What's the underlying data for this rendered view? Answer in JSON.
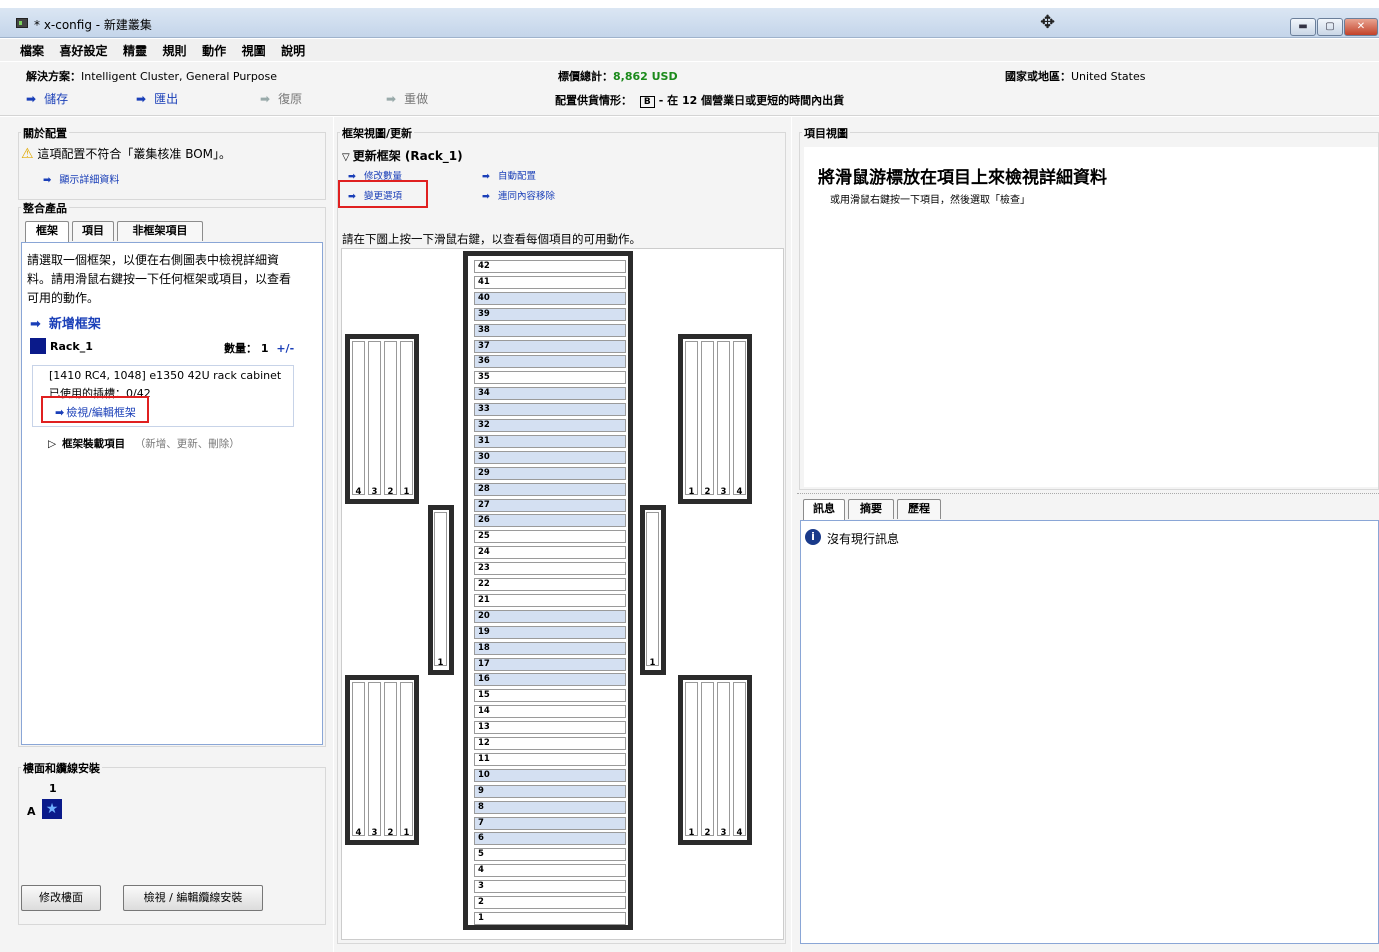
{
  "window": {
    "title": "* x-config - 新建叢集"
  },
  "menu": [
    "檔案",
    "喜好設定",
    "精靈",
    "規則",
    "動作",
    "視圖",
    "說明"
  ],
  "infobar": {
    "solution_label": "解決方案：",
    "solution_value": "Intelligent Cluster, General Purpose",
    "price_label": "標價總計：",
    "price_value": "8,862 USD",
    "country_label": "國家或地區：",
    "country_value": "United States",
    "save": "儲存",
    "export": "匯出",
    "undo": "復原",
    "redo": "重做",
    "supply_label": "配置供貨情形：",
    "supply_badge": "B",
    "supply_text": "- 在 12 個營業日或更短的時間內出貨"
  },
  "about": {
    "title": "關於配置",
    "warning": "這項配置不符合「叢集核准 BOM」。",
    "details_link": "顯示詳細資料"
  },
  "integrated": {
    "title": "整合產品",
    "tabs": [
      "框架",
      "項目",
      "非框架項目"
    ],
    "instructions": [
      "請選取一個框架，以便在右側圖表中檢視詳細資",
      "料。請用滑鼠右鍵按一下任何框架或項目，以查看",
      "可用的動作。"
    ],
    "add_rack": "新增框架",
    "rack_name": "Rack_1",
    "qty_label": "數量：",
    "qty_value": "1",
    "qty_adjust": "+/-",
    "rack_desc": "[1410 RC4, 1048] e1350 42U rack cabinet",
    "slots_used": "已使用的插槽：0/42",
    "view_edit_rack": "檢視/編輯框架",
    "rack_items": "框架裝載項目",
    "rack_items_hint": "（新增、更新、刪除）"
  },
  "floor": {
    "title": "樓面和纜線安裝",
    "col_label": "1",
    "row_label": "A",
    "modify_button": "修改樓面",
    "cabling_button": "檢視 / 編輯纜線安裝"
  },
  "rackview": {
    "title": "框架視圖/更新",
    "update_header": "更新框架 (Rack_1)",
    "modify_qty": "修改數量",
    "auto_config": "自動配置",
    "change_option": "變更選項",
    "move_contents": "連同內容移除",
    "instruction": "請在下圖上按一下滑鼠右鍵，以查看每個項目的可用動作。",
    "slots": [
      "42",
      "41",
      "40",
      "39",
      "38",
      "37",
      "36",
      "35",
      "34",
      "33",
      "32",
      "31",
      "30",
      "29",
      "28",
      "27",
      "26",
      "25",
      "24",
      "23",
      "22",
      "21",
      "20",
      "19",
      "18",
      "17",
      "16",
      "15",
      "14",
      "13",
      "12",
      "11",
      "10",
      "9",
      "8",
      "7",
      "6",
      "5",
      "4",
      "3",
      "2",
      "1"
    ],
    "pdu_left_labels": [
      "4",
      "3",
      "2",
      "1"
    ],
    "pdu_right_labels": [
      "1",
      "2",
      "3",
      "4"
    ],
    "side_pdu_label": "1"
  },
  "itemview": {
    "title": "項目視圖",
    "headline": "將滑鼠游標放在項目上來檢視詳細資料",
    "subline": "或用滑鼠右鍵按一下項目，然後選取「檢查」"
  },
  "messages": {
    "tabs": [
      "訊息",
      "摘要",
      "歷程"
    ],
    "no_messages": "沒有現行訊息"
  }
}
